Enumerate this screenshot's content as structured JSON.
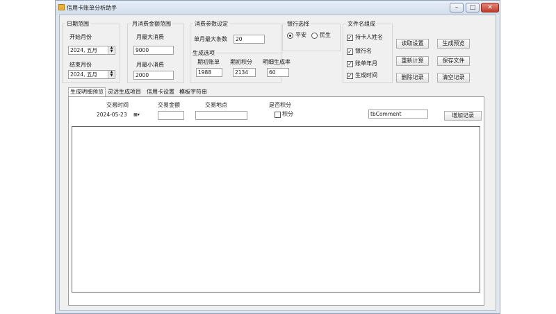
{
  "window": {
    "title": "信用卡账单分析助手"
  },
  "date_range": {
    "title": "日期范围",
    "start_label": "开始月份",
    "start_value": "2024, 五月",
    "end_label": "结束月份",
    "end_value": "2024, 五月"
  },
  "monthly_amount": {
    "title": "月消费金额范围",
    "max_label": "月最大消费",
    "max_value": "9000",
    "min_label": "月最小消费",
    "min_value": "2000"
  },
  "other_params": {
    "title": "消费参数设定",
    "max_count_label": "单月最大条数",
    "max_count_value": "20",
    "generate_title": "生成选项",
    "initial_bill_label": "期初账单",
    "initial_bill_value": "1988",
    "initial_points_label": "期初积分",
    "initial_points_value": "2134",
    "detail_gen_label": "明细生成率",
    "detail_gen_value": "60"
  },
  "bank": {
    "title": "银行选择",
    "options": [
      "平安",
      "民生"
    ],
    "selected": "平安"
  },
  "filename": {
    "title": "文件名组成",
    "items": [
      "持卡人姓名",
      "银行名",
      "账单年月",
      "生成时间"
    ]
  },
  "buttons": {
    "read_settings": "读取设置",
    "generate_preview": "生成预览",
    "recalculate": "重新计算",
    "save_file": "保存文件",
    "delete_record": "删除记录",
    "clear_records": "清空记录",
    "add_record": "增加记录"
  },
  "tabs": [
    "生成明细预览",
    "灵活生成项目",
    "信用卡设置",
    "模板字符串"
  ],
  "record_form": {
    "time_label": "交易时间",
    "time_value": "2024-05-23",
    "amount_label": "交易金额",
    "amount_value": "",
    "place_label": "交易地点",
    "place_value": "",
    "points_label": "是否积分",
    "points_check_label": "积分",
    "comment_value": "tbComment"
  }
}
